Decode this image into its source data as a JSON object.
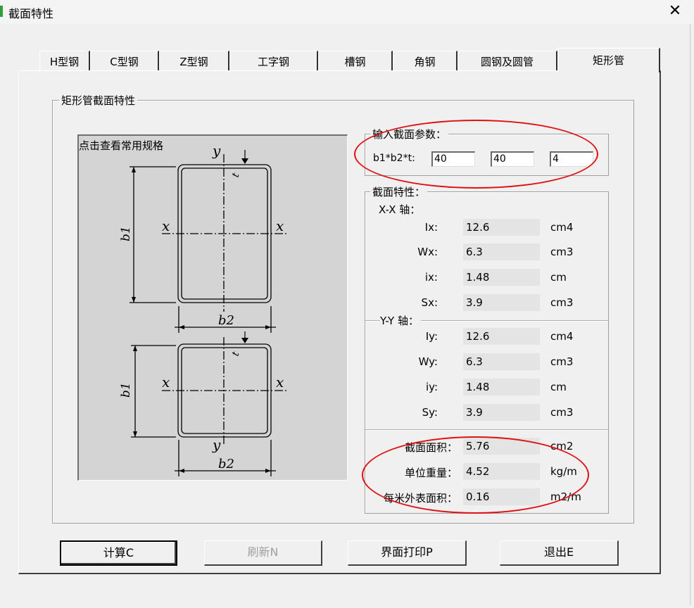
{
  "window": {
    "title": "截面特性",
    "close_glyph": "✕"
  },
  "tabs": [
    {
      "label": "H型钢"
    },
    {
      "label": "C型钢"
    },
    {
      "label": "Z型钢"
    },
    {
      "label": "工字钢"
    },
    {
      "label": "槽钢"
    },
    {
      "label": "角钢"
    },
    {
      "label": "圆钢及圆管"
    },
    {
      "label": "矩形管",
      "active": true
    }
  ],
  "main_group": {
    "legend": "矩形管截面特性"
  },
  "drawing": {
    "caption": "点击查看常用规格",
    "labels": {
      "y": "y",
      "x": "x",
      "b1": "b1",
      "b2": "b2",
      "t": "t"
    }
  },
  "input_group": {
    "legend": "输入截面参数：",
    "param_label": "b1*b2*t:",
    "b1": "40",
    "b2": "40",
    "t": "4"
  },
  "props_group": {
    "legend": "截面特性：",
    "xx_axis": "X-X 轴：",
    "yy_axis": "Y-Y 轴：",
    "rows": [
      {
        "label": "Ix:",
        "value": "12.6",
        "unit": "cm4"
      },
      {
        "label": "Wx:",
        "value": "6.3",
        "unit": "cm3"
      },
      {
        "label": "ix:",
        "value": "1.48",
        "unit": "cm"
      },
      {
        "label": "Sx:",
        "value": "3.9",
        "unit": "cm3"
      },
      {
        "label": "Iy:",
        "value": "12.6",
        "unit": "cm4"
      },
      {
        "label": "Wy:",
        "value": "6.3",
        "unit": "cm3"
      },
      {
        "label": "iy:",
        "value": "1.48",
        "unit": "cm"
      },
      {
        "label": "Sy:",
        "value": "3.9",
        "unit": "cm3"
      }
    ],
    "bottom_rows": [
      {
        "label": "截面面积：",
        "value": "5.76",
        "unit": "cm2"
      },
      {
        "label": "单位重量：",
        "value": "4.52",
        "unit": "kg/m"
      },
      {
        "label": "每米外表面积：",
        "value": "0.16",
        "unit": "m2/m"
      }
    ]
  },
  "buttons": {
    "calc": "计算C",
    "refresh": "刷新N",
    "print": "界面打印P",
    "exit": "退出E"
  },
  "colors": {
    "annotation": "#e01010",
    "tab_border": "#303030"
  }
}
